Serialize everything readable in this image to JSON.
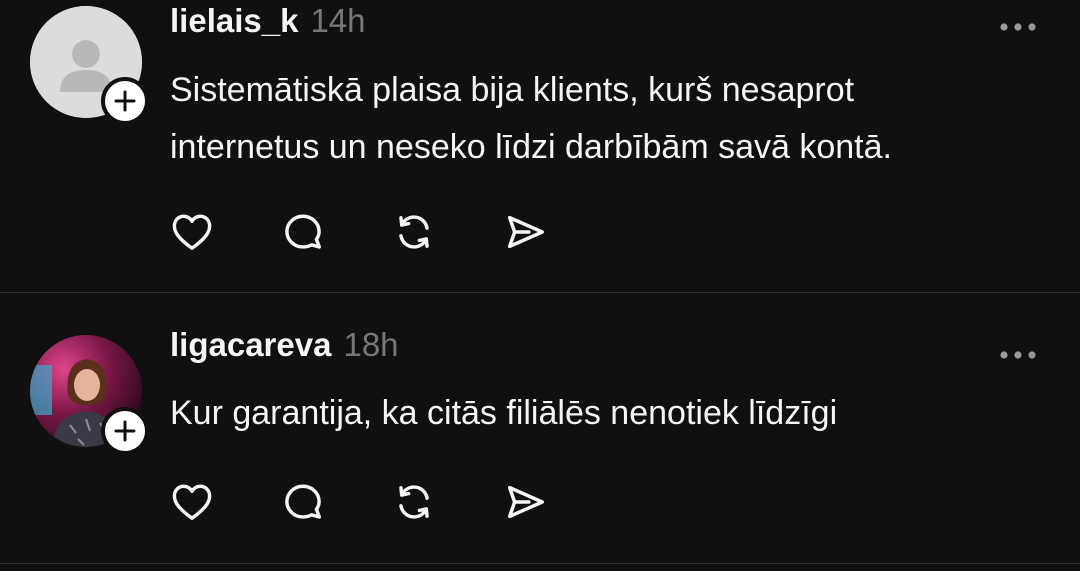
{
  "posts": [
    {
      "username": "lielais_k",
      "timestamp": "14h",
      "text_lines": [
        "Sistemātiskā plaisa bija klients, kurš nesaprot",
        "internetus un neseko līdzi darbībām savā kontā."
      ],
      "avatar": "default-avatar-icon"
    },
    {
      "username": "ligacareva",
      "timestamp": "18h",
      "text_lines": [
        "Kur garantija, ka citās filiālēs nenotiek līdzīgi"
      ],
      "avatar": "profile-photo"
    }
  ],
  "colors": {
    "background": "#101010",
    "text": "#f3f5f7",
    "muted": "#777777",
    "divider": "#2e2e2e"
  }
}
